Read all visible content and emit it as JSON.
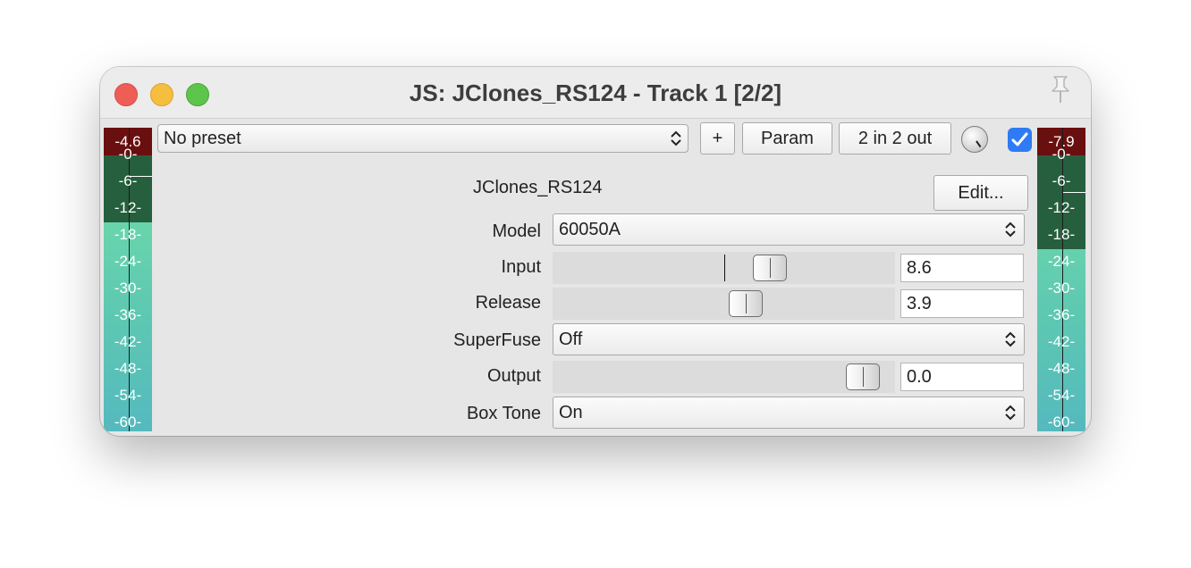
{
  "window": {
    "title": "JS: JClones_RS124 - Track 1 [2/2]"
  },
  "meters": {
    "ticks": [
      "-0-",
      "-6-",
      "-12-",
      "-18-",
      "-24-",
      "-30-",
      "-36-",
      "-42-",
      "-48-",
      "-54-",
      "-60-"
    ],
    "left": {
      "peak": "-4.6",
      "level_db": -15
    },
    "right": {
      "peak": "-7.9",
      "level_db": -21
    }
  },
  "toolbar": {
    "preset": "No preset",
    "add_label": "+",
    "param_label": "Param",
    "io_label": "2 in 2 out",
    "bypass_checked": true
  },
  "plugin": {
    "name": "JClones_RS124",
    "edit_label": "Edit..."
  },
  "params": {
    "model": {
      "label": "Model",
      "value": "60050A"
    },
    "input": {
      "label": "Input",
      "value": "8.6",
      "slider_fraction": 0.65
    },
    "release": {
      "label": "Release",
      "value": "3.9",
      "slider_fraction": 0.57
    },
    "superfuse": {
      "label": "SuperFuse",
      "value": "Off"
    },
    "output": {
      "label": "Output",
      "value": "0.0",
      "slider_fraction": 0.95
    },
    "box_tone": {
      "label": "Box Tone",
      "value": "On"
    }
  }
}
